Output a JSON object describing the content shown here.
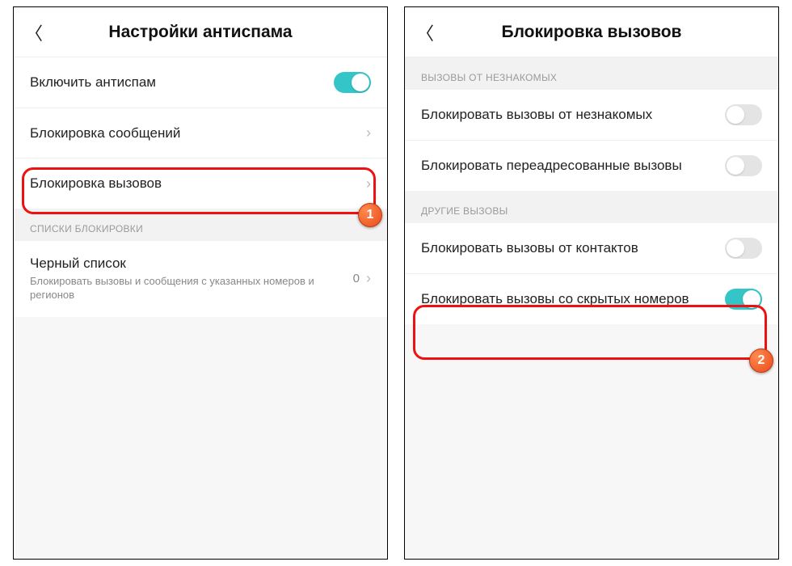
{
  "left": {
    "title": "Настройки антиспама",
    "rows": {
      "enable": "Включить антиспам",
      "msg_block": "Блокировка сообщений",
      "call_block": "Блокировка вызовов",
      "section": "СПИСКИ БЛОКИРОВКИ",
      "blacklist": "Черный список",
      "blacklist_sub": "Блокировать вызовы и сообщения с указанных номеров и регионов",
      "blacklist_count": "0"
    },
    "badge": "1"
  },
  "right": {
    "title": "Блокировка вызовов",
    "section1": "ВЫЗОВЫ ОТ НЕЗНАКОМЫХ",
    "rows": {
      "unknown": "Блокировать вызовы от незнакомых",
      "forwarded": "Блокировать переадресованные вызовы",
      "section2": "ДРУГИЕ ВЫЗОВЫ",
      "contacts": "Блокировать вызовы от контактов",
      "hidden": "Блокировать вызовы со скрытых номеров"
    },
    "badge": "2"
  }
}
